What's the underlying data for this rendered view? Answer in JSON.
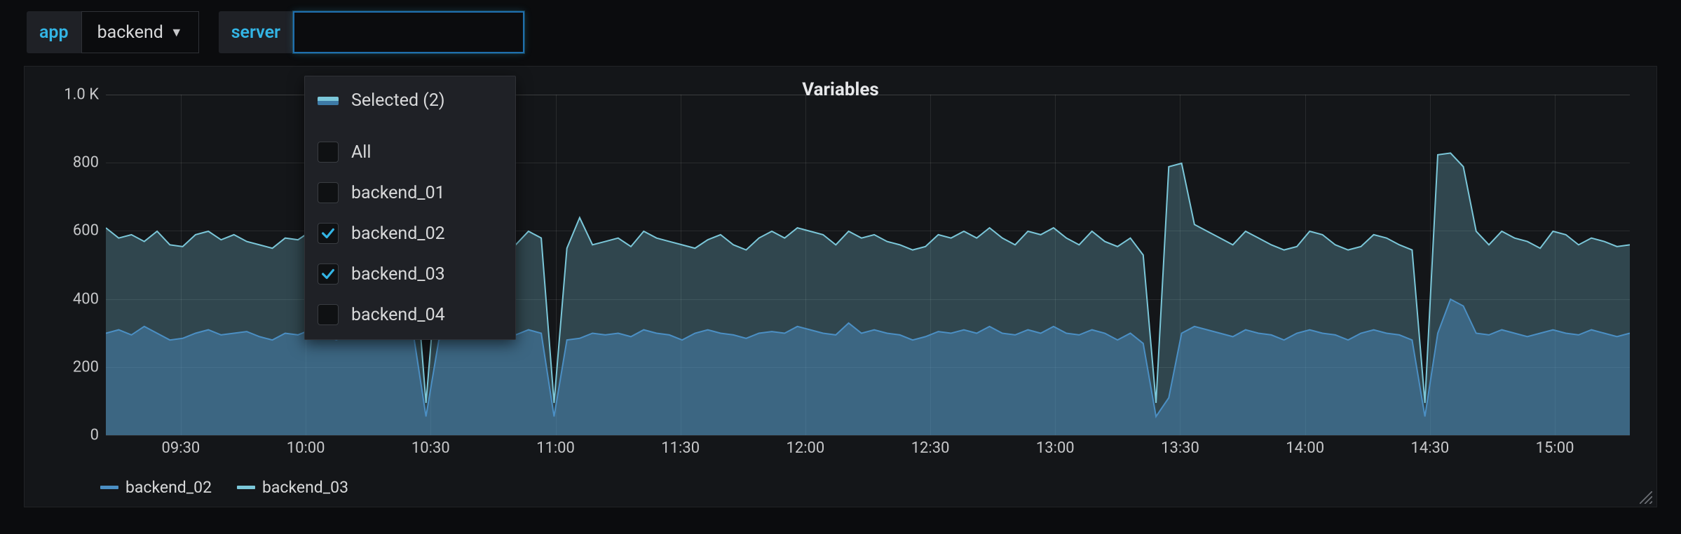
{
  "toolbar": {
    "app_label": "app",
    "app_value": "backend",
    "server_label": "server",
    "server_input_value": ""
  },
  "dropdown": {
    "selected_label": "Selected (2)",
    "options": [
      {
        "label": "All",
        "checked": false
      },
      {
        "label": "backend_01",
        "checked": false
      },
      {
        "label": "backend_02",
        "checked": true
      },
      {
        "label": "backend_03",
        "checked": true
      },
      {
        "label": "backend_04",
        "checked": false
      }
    ]
  },
  "panel": {
    "title": "Variables",
    "legend": [
      {
        "name": "backend_02",
        "color": "#4b8fc4"
      },
      {
        "name": "backend_03",
        "color": "#7bc7d9"
      }
    ]
  },
  "chart_data": {
    "type": "area",
    "xlabel": "",
    "ylabel": "",
    "ylim": [
      0,
      1000
    ],
    "y_ticks": [
      "0",
      "200",
      "400",
      "600",
      "800",
      "1.0 K"
    ],
    "x_categories": [
      "09:30",
      "10:00",
      "10:30",
      "11:00",
      "11:30",
      "12:00",
      "12:30",
      "13:00",
      "13:30",
      "14:00",
      "14:30",
      "15:00"
    ],
    "series": [
      {
        "name": "backend_02",
        "color": "#4b8fc4",
        "values": [
          300,
          310,
          295,
          320,
          300,
          280,
          285,
          300,
          310,
          295,
          300,
          305,
          290,
          280,
          300,
          295,
          310,
          300,
          280,
          300,
          295,
          310,
          300,
          285,
          300,
          55,
          280,
          300,
          290,
          305,
          300,
          300,
          295,
          310,
          300,
          55,
          280,
          285,
          300,
          295,
          300,
          290,
          310,
          300,
          295,
          280,
          300,
          310,
          300,
          295,
          285,
          300,
          305,
          300,
          320,
          310,
          300,
          295,
          330,
          300,
          310,
          300,
          295,
          280,
          290,
          305,
          300,
          310,
          300,
          320,
          300,
          295,
          310,
          300,
          320,
          300,
          295,
          310,
          300,
          280,
          300,
          270,
          55,
          110,
          300,
          320,
          310,
          300,
          290,
          310,
          300,
          295,
          280,
          300,
          310,
          300,
          295,
          280,
          300,
          310,
          300,
          295,
          280,
          55,
          300,
          400,
          380,
          300,
          295,
          310,
          300,
          290,
          300,
          310,
          300,
          295,
          310,
          300,
          290,
          300
        ]
      },
      {
        "name": "backend_03",
        "color": "#7bc7d9",
        "values": [
          610,
          580,
          590,
          570,
          600,
          560,
          555,
          590,
          600,
          575,
          590,
          570,
          560,
          550,
          580,
          575,
          600,
          590,
          555,
          560,
          570,
          590,
          580,
          560,
          570,
          95,
          550,
          570,
          560,
          580,
          575,
          570,
          560,
          600,
          580,
          95,
          550,
          640,
          560,
          570,
          580,
          555,
          600,
          580,
          570,
          560,
          550,
          575,
          590,
          560,
          545,
          580,
          600,
          580,
          610,
          600,
          590,
          560,
          600,
          580,
          590,
          570,
          560,
          545,
          555,
          590,
          580,
          600,
          580,
          610,
          580,
          560,
          600,
          590,
          610,
          580,
          560,
          600,
          570,
          555,
          580,
          530,
          95,
          790,
          800,
          620,
          600,
          580,
          560,
          600,
          580,
          560,
          545,
          555,
          600,
          590,
          560,
          545,
          555,
          590,
          580,
          560,
          545,
          95,
          825,
          830,
          790,
          600,
          560,
          600,
          580,
          570,
          550,
          600,
          590,
          560,
          580,
          570,
          555,
          560
        ]
      }
    ]
  }
}
